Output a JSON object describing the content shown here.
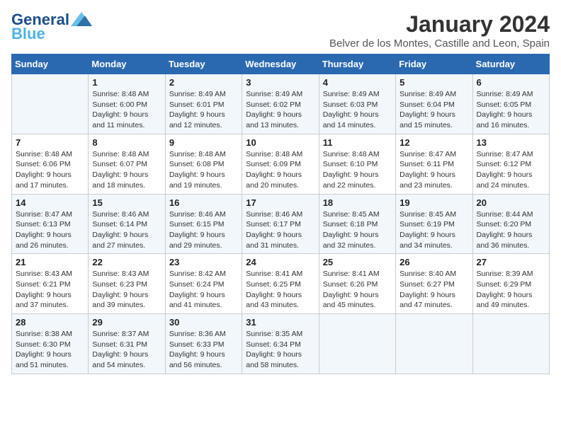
{
  "logo": {
    "line1": "General",
    "line2": "Blue"
  },
  "title": "January 2024",
  "subtitle": "Belver de los Montes, Castille and Leon, Spain",
  "weekdays": [
    "Sunday",
    "Monday",
    "Tuesday",
    "Wednesday",
    "Thursday",
    "Friday",
    "Saturday"
  ],
  "weeks": [
    [
      {
        "day": "",
        "info": ""
      },
      {
        "day": "1",
        "info": "Sunrise: 8:48 AM\nSunset: 6:00 PM\nDaylight: 9 hours\nand 11 minutes."
      },
      {
        "day": "2",
        "info": "Sunrise: 8:49 AM\nSunset: 6:01 PM\nDaylight: 9 hours\nand 12 minutes."
      },
      {
        "day": "3",
        "info": "Sunrise: 8:49 AM\nSunset: 6:02 PM\nDaylight: 9 hours\nand 13 minutes."
      },
      {
        "day": "4",
        "info": "Sunrise: 8:49 AM\nSunset: 6:03 PM\nDaylight: 9 hours\nand 14 minutes."
      },
      {
        "day": "5",
        "info": "Sunrise: 8:49 AM\nSunset: 6:04 PM\nDaylight: 9 hours\nand 15 minutes."
      },
      {
        "day": "6",
        "info": "Sunrise: 8:49 AM\nSunset: 6:05 PM\nDaylight: 9 hours\nand 16 minutes."
      }
    ],
    [
      {
        "day": "7",
        "info": "Sunrise: 8:48 AM\nSunset: 6:06 PM\nDaylight: 9 hours\nand 17 minutes."
      },
      {
        "day": "8",
        "info": "Sunrise: 8:48 AM\nSunset: 6:07 PM\nDaylight: 9 hours\nand 18 minutes."
      },
      {
        "day": "9",
        "info": "Sunrise: 8:48 AM\nSunset: 6:08 PM\nDaylight: 9 hours\nand 19 minutes."
      },
      {
        "day": "10",
        "info": "Sunrise: 8:48 AM\nSunset: 6:09 PM\nDaylight: 9 hours\nand 20 minutes."
      },
      {
        "day": "11",
        "info": "Sunrise: 8:48 AM\nSunset: 6:10 PM\nDaylight: 9 hours\nand 22 minutes."
      },
      {
        "day": "12",
        "info": "Sunrise: 8:47 AM\nSunset: 6:11 PM\nDaylight: 9 hours\nand 23 minutes."
      },
      {
        "day": "13",
        "info": "Sunrise: 8:47 AM\nSunset: 6:12 PM\nDaylight: 9 hours\nand 24 minutes."
      }
    ],
    [
      {
        "day": "14",
        "info": "Sunrise: 8:47 AM\nSunset: 6:13 PM\nDaylight: 9 hours\nand 26 minutes."
      },
      {
        "day": "15",
        "info": "Sunrise: 8:46 AM\nSunset: 6:14 PM\nDaylight: 9 hours\nand 27 minutes."
      },
      {
        "day": "16",
        "info": "Sunrise: 8:46 AM\nSunset: 6:15 PM\nDaylight: 9 hours\nand 29 minutes."
      },
      {
        "day": "17",
        "info": "Sunrise: 8:46 AM\nSunset: 6:17 PM\nDaylight: 9 hours\nand 31 minutes."
      },
      {
        "day": "18",
        "info": "Sunrise: 8:45 AM\nSunset: 6:18 PM\nDaylight: 9 hours\nand 32 minutes."
      },
      {
        "day": "19",
        "info": "Sunrise: 8:45 AM\nSunset: 6:19 PM\nDaylight: 9 hours\nand 34 minutes."
      },
      {
        "day": "20",
        "info": "Sunrise: 8:44 AM\nSunset: 6:20 PM\nDaylight: 9 hours\nand 36 minutes."
      }
    ],
    [
      {
        "day": "21",
        "info": "Sunrise: 8:43 AM\nSunset: 6:21 PM\nDaylight: 9 hours\nand 37 minutes."
      },
      {
        "day": "22",
        "info": "Sunrise: 8:43 AM\nSunset: 6:23 PM\nDaylight: 9 hours\nand 39 minutes."
      },
      {
        "day": "23",
        "info": "Sunrise: 8:42 AM\nSunset: 6:24 PM\nDaylight: 9 hours\nand 41 minutes."
      },
      {
        "day": "24",
        "info": "Sunrise: 8:41 AM\nSunset: 6:25 PM\nDaylight: 9 hours\nand 43 minutes."
      },
      {
        "day": "25",
        "info": "Sunrise: 8:41 AM\nSunset: 6:26 PM\nDaylight: 9 hours\nand 45 minutes."
      },
      {
        "day": "26",
        "info": "Sunrise: 8:40 AM\nSunset: 6:27 PM\nDaylight: 9 hours\nand 47 minutes."
      },
      {
        "day": "27",
        "info": "Sunrise: 8:39 AM\nSunset: 6:29 PM\nDaylight: 9 hours\nand 49 minutes."
      }
    ],
    [
      {
        "day": "28",
        "info": "Sunrise: 8:38 AM\nSunset: 6:30 PM\nDaylight: 9 hours\nand 51 minutes."
      },
      {
        "day": "29",
        "info": "Sunrise: 8:37 AM\nSunset: 6:31 PM\nDaylight: 9 hours\nand 54 minutes."
      },
      {
        "day": "30",
        "info": "Sunrise: 8:36 AM\nSunset: 6:33 PM\nDaylight: 9 hours\nand 56 minutes."
      },
      {
        "day": "31",
        "info": "Sunrise: 8:35 AM\nSunset: 6:34 PM\nDaylight: 9 hours\nand 58 minutes."
      },
      {
        "day": "",
        "info": ""
      },
      {
        "day": "",
        "info": ""
      },
      {
        "day": "",
        "info": ""
      }
    ]
  ]
}
